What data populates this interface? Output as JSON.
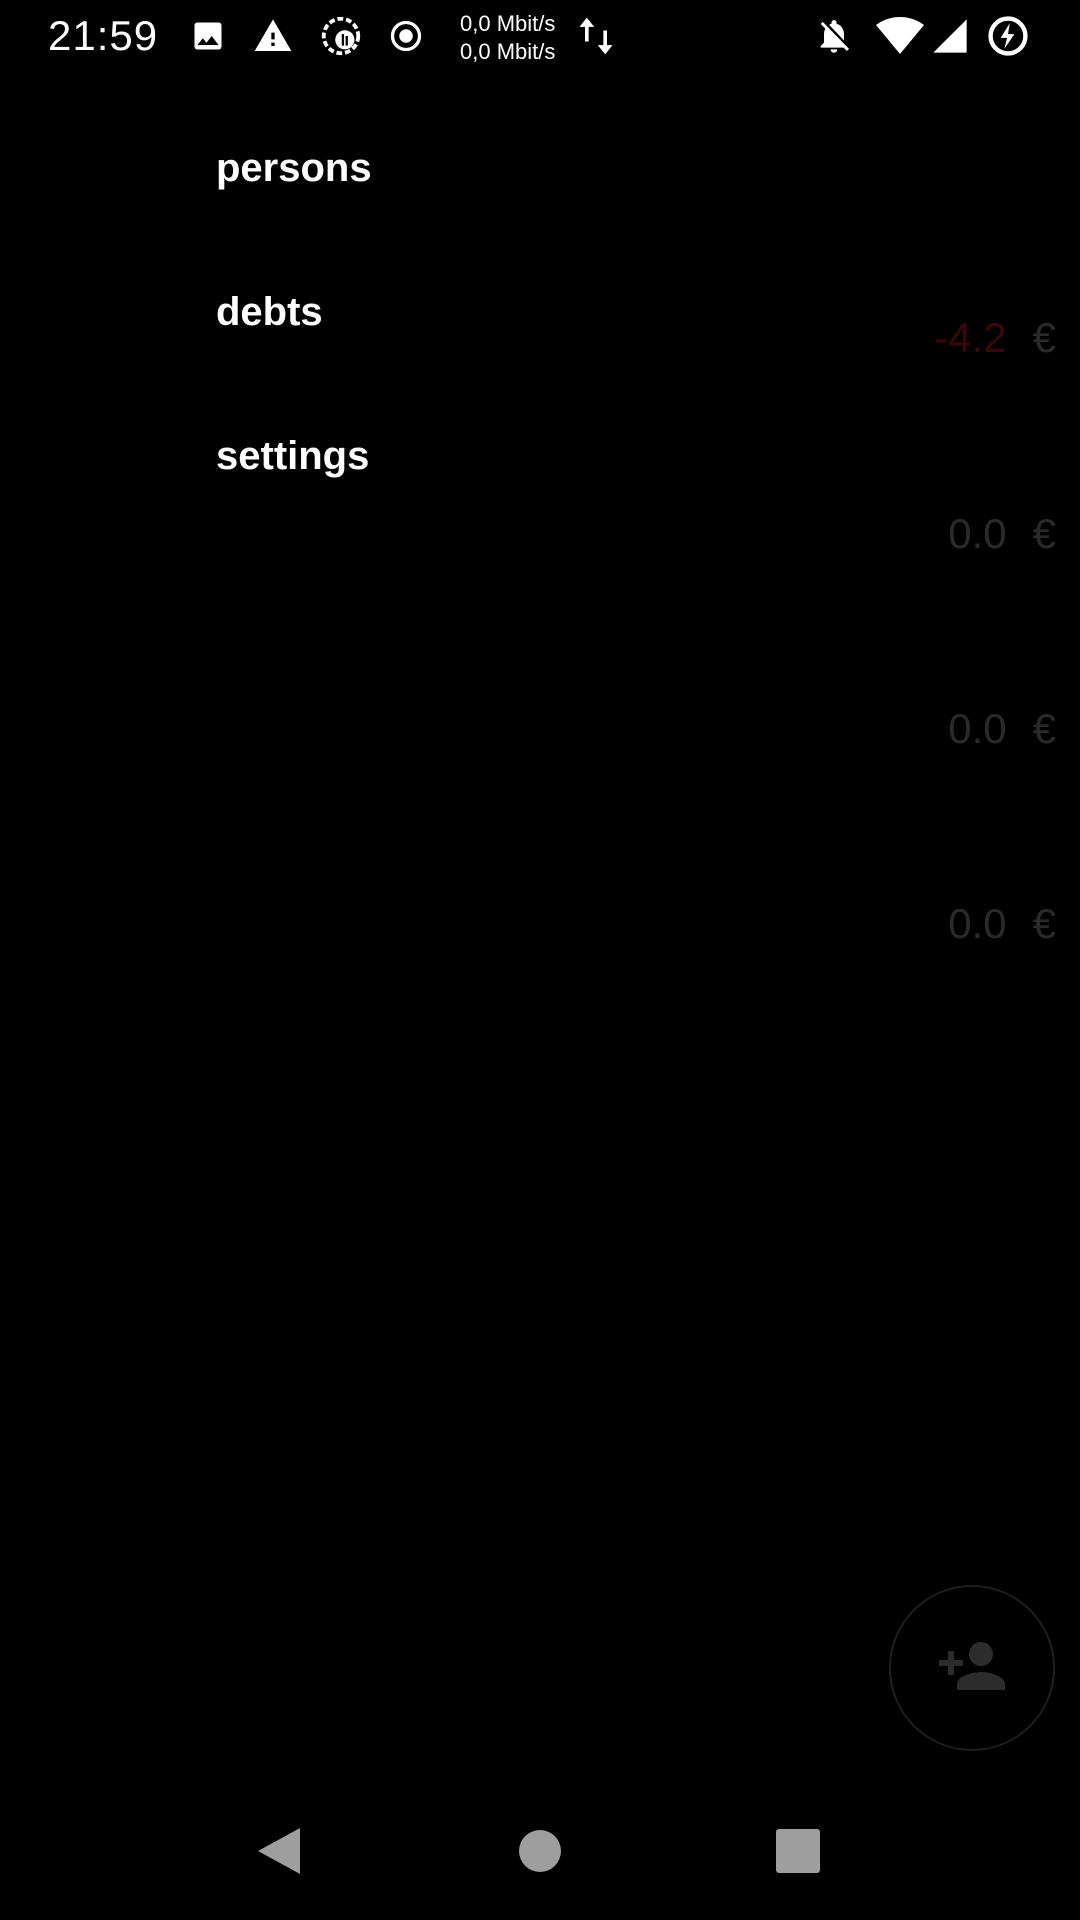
{
  "status_bar": {
    "time": "21:59",
    "speed_up": "0,0 Mbit/s",
    "speed_down": "0,0 Mbit/s",
    "left_icons": [
      "image-icon",
      "warning-icon",
      "data-saver-icon",
      "record-icon"
    ],
    "right_icons": [
      "notifications-off-icon",
      "wifi-icon",
      "cell-signal-icon",
      "battery-charging-icon"
    ]
  },
  "drawer": {
    "items": [
      {
        "label": "persons"
      },
      {
        "label": "debts"
      },
      {
        "label": "settings"
      }
    ]
  },
  "background_list": {
    "rows": [
      {
        "value": "-4.2",
        "currency": "€",
        "negative": true
      },
      {
        "value": "0.0",
        "currency": "€",
        "negative": false
      },
      {
        "value": "0.0",
        "currency": "€",
        "negative": false
      },
      {
        "value": "0.0",
        "currency": "€",
        "negative": false
      }
    ]
  },
  "fab": {
    "icon": "add-person-icon"
  },
  "nav_bar": {
    "buttons": [
      "back-icon",
      "home-icon",
      "recents-icon"
    ]
  },
  "colors": {
    "background": "#000000",
    "text": "#ffffff",
    "negative_amount": "#3a0808",
    "dim_text": "#2a2a2a"
  }
}
